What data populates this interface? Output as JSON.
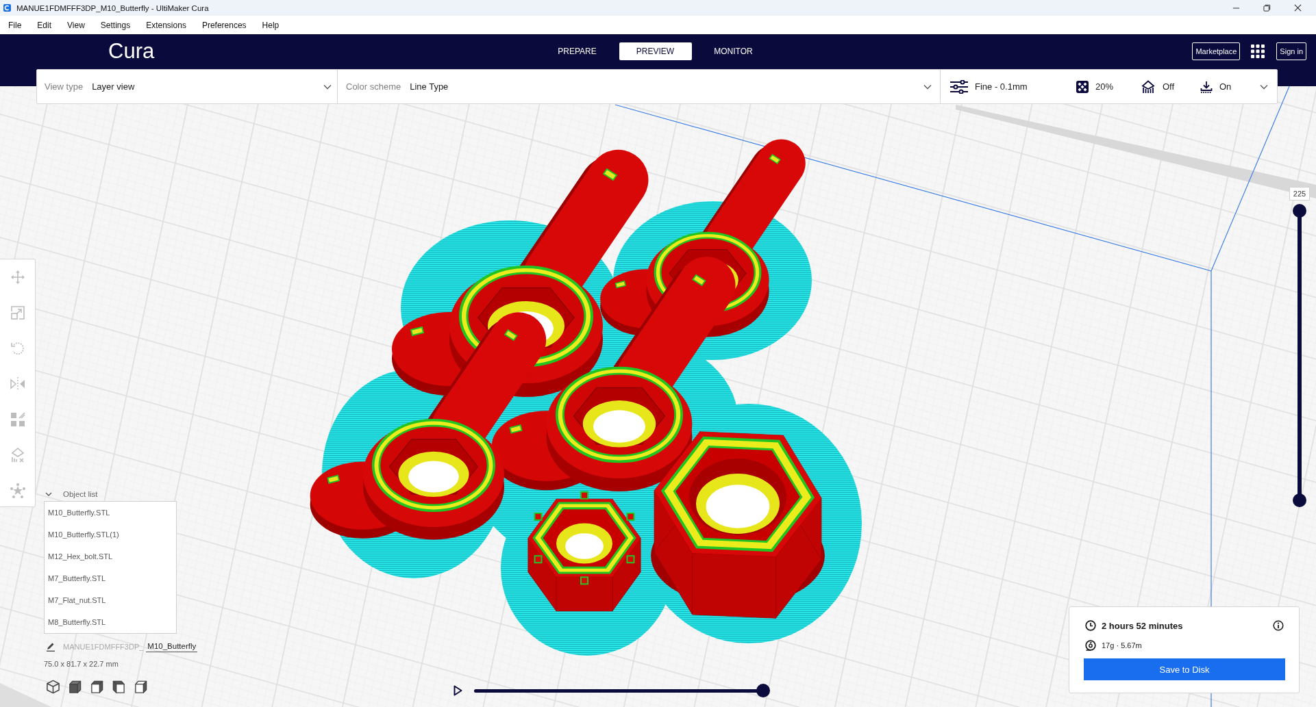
{
  "window": {
    "title": "MANUE1FDMFFF3DP_M10_Butterfly - UltiMaker Cura"
  },
  "menu": [
    "File",
    "Edit",
    "View",
    "Settings",
    "Extensions",
    "Preferences",
    "Help"
  ],
  "header": {
    "logo": "Cura",
    "stages": [
      {
        "label": "PREPARE",
        "selected": false
      },
      {
        "label": "PREVIEW",
        "selected": true
      },
      {
        "label": "MONITOR",
        "selected": false
      }
    ],
    "marketplace": "Marketplace",
    "sign_in": "Sign in"
  },
  "view_bar": {
    "view_type": {
      "label": "View type",
      "value": "Layer view"
    },
    "color_scheme": {
      "label": "Color scheme",
      "value": "Line Type"
    },
    "print_setup": {
      "profile": "Fine - 0.1mm",
      "infill": "20%",
      "support": "Off",
      "adhesion": "On"
    }
  },
  "toolbar": {
    "disabled": true
  },
  "object_list": {
    "title": "Object list",
    "expanded": true,
    "items": [
      {
        "name": "M10_Butterfly.STL",
        "selected": false
      },
      {
        "name": "M10_Butterfly.STL(1)",
        "selected": false
      },
      {
        "name": "M12_Hex_bolt.STL",
        "selected": false
      },
      {
        "name": "M7_Butterfly.STL",
        "selected": false
      },
      {
        "name": "M7_Flat_nut.STL",
        "selected": false
      },
      {
        "name": "M8_Butterfly.STL",
        "selected": false
      }
    ]
  },
  "job": {
    "prefix": "MANUE1FDMFFF3DP_",
    "name": "M10_Butterfly",
    "dimensions": "75.0 x 81.7 x 22.7 mm"
  },
  "layer_slider": {
    "label": "225",
    "upper": {
      "level": 1
    },
    "lower": {
      "level": 0
    }
  },
  "path_slider": {
    "level": 1
  },
  "print_info": {
    "time": "2 hours 52 minutes",
    "material": "17g · 5.67m",
    "action": "Save to Disk"
  }
}
